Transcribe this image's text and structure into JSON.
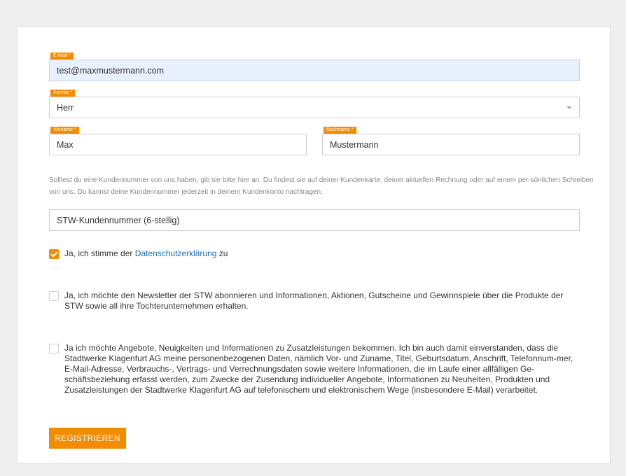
{
  "form": {
    "email": {
      "label": "E-Mail *",
      "value": "test@maxmustermann.com"
    },
    "anrede": {
      "label": "Anrede *",
      "value": "Herr"
    },
    "vorname": {
      "label": "Vorname *",
      "value": "Max"
    },
    "nachname": {
      "label": "Nachname *",
      "value": "Mustermann"
    },
    "hint": "Solltest du eine Kundennummer von uns haben, gib sie bitte hier an. Du findest sie auf deiner Kundenkarte, deiner aktuellen Rechnung oder auf einem per-sönlichen Schreiben von uns. Du kannst deine Kundennummer jederzeit in deinem Kundenkonto nachtragen.",
    "kundennummer": {
      "placeholder": "STW-Kundennummer (6-stellig)"
    },
    "privacy": {
      "checked": true,
      "prefix": "Ja, ich stimme der ",
      "link": "Datenschutzerklärung",
      "suffix": " zu"
    },
    "newsletter": {
      "checked": false,
      "text": "Ja, ich möchte den Newsletter der STW abonnieren und Informationen, Aktionen, Gutscheine und Gewinnspiele über die Produkte der STW sowie all ihre Tochterunternehmen erhalten."
    },
    "offers": {
      "checked": false,
      "text": "Ja ich möchte Angebote, Neuigkeiten und Informationen zu Zusatzleistungen bekommen. Ich bin auch damit einverstanden, dass die Stadtwerke Klagenfurt AG meine personenbezogenen Daten, nämlich Vor- und Zuname, Titel, Geburtsdatum, Anschrift, Telefonnum-mer, E-Mail-Adresse, Verbrauchs-, Vertrags- und Verrechnungsdaten sowie weitere Informationen, die im Laufe einer allfälligen Ge-schäftsbeziehung erfasst werden, zum Zwecke der Zusendung individueller Angebote, Informationen zu Neuheiten, Produkten und Zusatzleistungen der Stadtwerke Klagenfurt AG auf telefonischem und elektronischem Wege (insbesondere E-Mail) verarbeitet."
    },
    "submit_label": "REGISTRIEREN"
  },
  "colors": {
    "accent": "#f28c00",
    "link": "#1a6fb5",
    "autofill": "#e8f0fe"
  },
  "icons": {
    "select": "chevron-down-icon",
    "check": "check-icon"
  }
}
